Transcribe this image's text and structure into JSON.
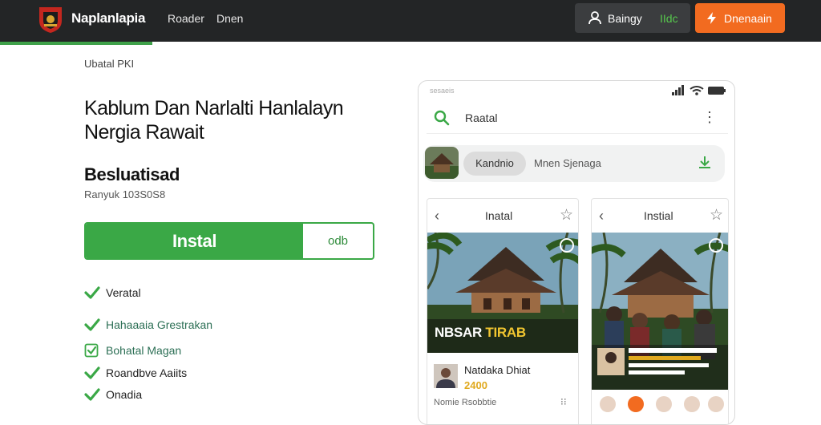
{
  "header": {
    "brand": "Naplanlapia",
    "nav": [
      "Roader",
      "Dnen"
    ],
    "user_name": "Baingy",
    "user_lang": "IIdc",
    "cta_label": "Dnenaain"
  },
  "colors": {
    "topbar": "#232526",
    "accent_green": "#3aa846",
    "cta_orange": "#f26b20"
  },
  "main": {
    "breadcrumb": "Ubatal PKI",
    "title_line1": "Kablum Dan Narlalti Hanlalayn",
    "title_line2": "Nergia Rawait",
    "subtitle": "Besluatisad",
    "subtitle_small": "Ranyuk 103S0S8",
    "install_label": "Instal",
    "install_alt": "odb"
  },
  "features": [
    {
      "label": "Veratal",
      "icon": "check-icon"
    },
    {
      "label": "Hahaaaia Grestrakan",
      "icon": "check-icon"
    },
    {
      "label": "Bohatal Magan",
      "icon": "checkbox-icon"
    },
    {
      "label": "Roandbve Aaiits",
      "icon": "check-icon"
    },
    {
      "label": "Onadia",
      "icon": "check-icon"
    }
  ],
  "phone": {
    "status_text": "sesaeis",
    "search_text": "Raatal",
    "chip1": "Kandnio",
    "chip2": "Mnen Sjenaga",
    "card1": {
      "title": "Inatal",
      "overlay_a": "NBSAR",
      "overlay_b": "TIRAB",
      "item_name": "Natdaka Dhiat",
      "item_price": "2400",
      "footer": "Nomie Rsobbtie"
    },
    "card2": {
      "title": "Instial"
    }
  }
}
